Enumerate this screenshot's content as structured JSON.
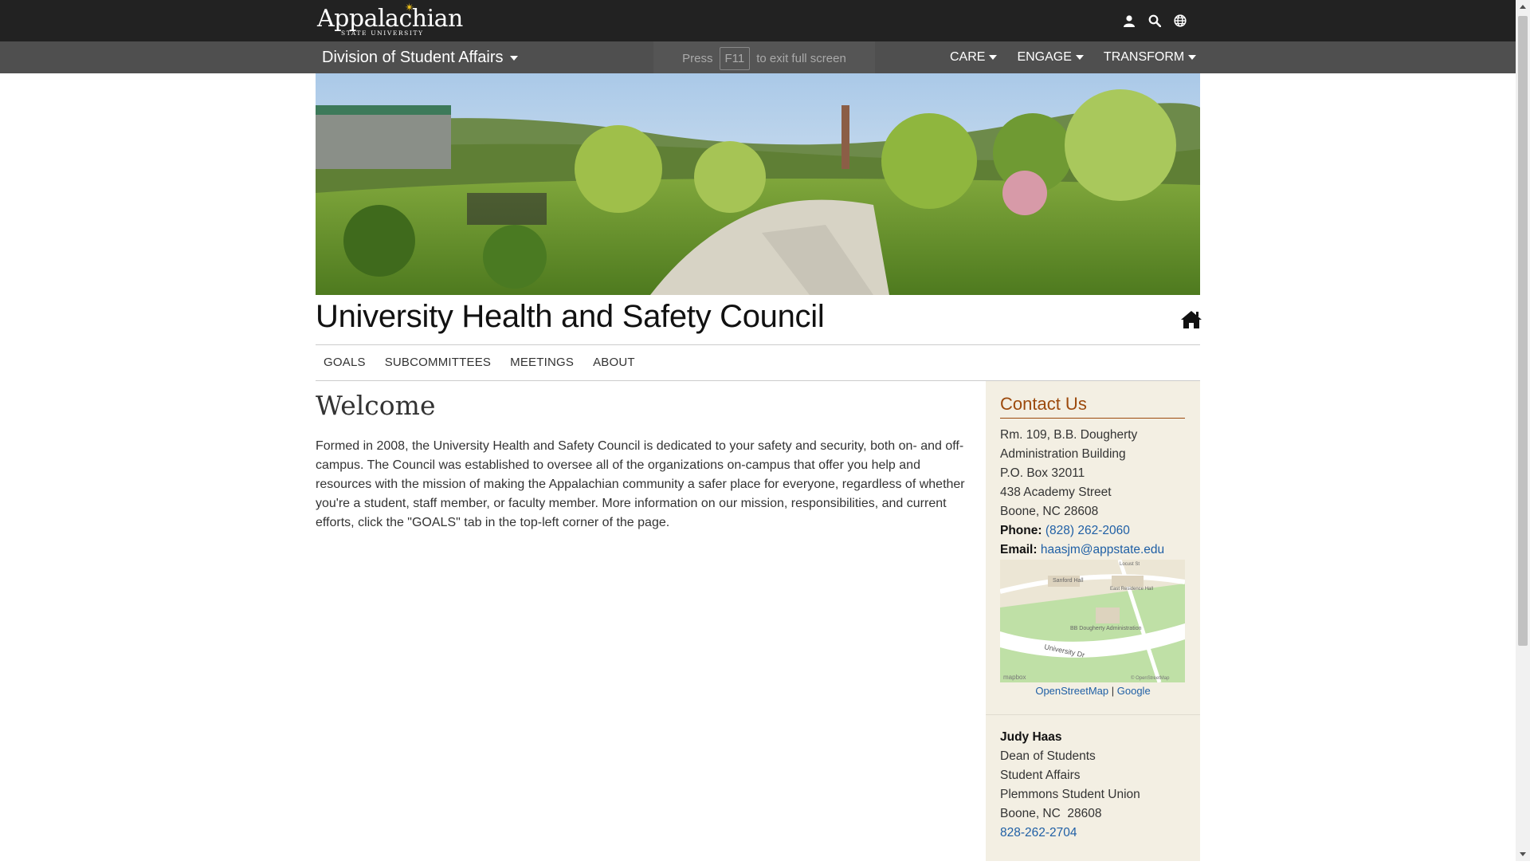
{
  "brand": {
    "logo_word": "Appalachian",
    "logo_sub": "STATE UNIVERSITY"
  },
  "top_icons": [
    "user-icon",
    "search-icon",
    "globe-icon"
  ],
  "division": {
    "title": "Division of Student Affairs",
    "nav": [
      {
        "label": "CARE"
      },
      {
        "label": "ENGAGE"
      },
      {
        "label": "TRANSFORM"
      }
    ]
  },
  "fullscreen_toast": {
    "press": "Press",
    "key": "F11",
    "message": "to exit full screen"
  },
  "page": {
    "title": "University Health and Safety Council",
    "subnav": [
      {
        "label": "GOALS"
      },
      {
        "label": "SUBCOMMITTEES"
      },
      {
        "label": "MEETINGS"
      },
      {
        "label": "ABOUT"
      }
    ]
  },
  "main": {
    "heading": "Welcome",
    "intro": "Formed in 2008, the University Health and Safety Council is dedicated to your safety and security, both on- and off-campus. The Council was established to oversee all of the organizations on-campus that offer you help and resources with the mission of making the Appalachian community a safer place for everyone, regardless of whether you're a student, staff member, or faculty member. More information on our mission, responsibilities, and current efforts, click the \"GOALS\" tab in the top-left corner of the page."
  },
  "sidebar": {
    "heading": "Contact Us",
    "address_lines": [
      "Rm. 109, B.B. Dougherty",
      "Administration Building",
      "P.O. Box 32011",
      "438 Academy Street",
      "Boone, NC 28608"
    ],
    "phone_label": "Phone:",
    "phone": "(828) 262-2060",
    "email_label": "Email:",
    "email": "haasjm@appstate.edu",
    "map": {
      "labels": [
        "Sanford Hall",
        "East Residence Hall",
        "BB Dougherty Administration",
        "University Dr",
        "Locust St"
      ],
      "attribution_left": "mapbox",
      "attribution_right": "© OpenStreetMap"
    },
    "map_links": {
      "osm": "OpenStreetMap",
      "sep": "|",
      "google": "Google"
    },
    "person": {
      "name": "Judy Haas",
      "lines": [
        "Dean of Students",
        "Student Affairs",
        "Plemmons Student Union",
        "Boone, NC  28608"
      ],
      "phone": "828-262-2704"
    }
  }
}
